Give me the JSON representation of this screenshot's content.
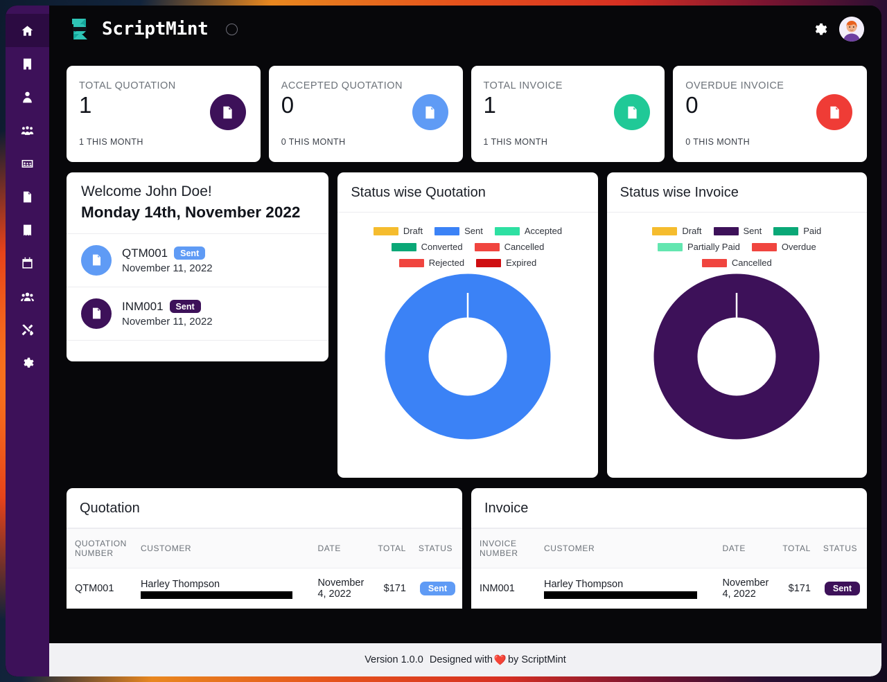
{
  "app": {
    "brand": "ScriptMint",
    "header_icons": {
      "gear": "gear-icon",
      "avatar": "user-avatar"
    }
  },
  "sidebar": {
    "items": [
      {
        "name": "home",
        "icon": "home-icon",
        "active": true
      },
      {
        "name": "company",
        "icon": "building-icon",
        "active": false
      },
      {
        "name": "client",
        "icon": "user-tie-icon",
        "active": false
      },
      {
        "name": "team",
        "icon": "users-cog-icon",
        "active": false
      },
      {
        "name": "meetings",
        "icon": "id-card-icon",
        "active": false
      },
      {
        "name": "quotation",
        "icon": "file-invoice-dollar-icon",
        "active": false
      },
      {
        "name": "invoice",
        "icon": "receipt-icon",
        "active": false
      },
      {
        "name": "calendar",
        "icon": "calendar-icon",
        "active": false
      },
      {
        "name": "users",
        "icon": "users-icon",
        "active": false
      },
      {
        "name": "tools",
        "icon": "tools-icon",
        "active": false
      },
      {
        "name": "settings",
        "icon": "gear-icon",
        "active": false
      }
    ]
  },
  "stats": [
    {
      "title": "TOTAL QUOTATION",
      "value": "1",
      "sub": "1 THIS MONTH",
      "color": "#3d1159",
      "icon": "file-invoice-dollar-icon"
    },
    {
      "title": "ACCEPTED QUOTATION",
      "value": "0",
      "sub": "0 THIS MONTH",
      "color": "#5f9bf5",
      "icon": "file-invoice-dollar-icon"
    },
    {
      "title": "TOTAL INVOICE",
      "value": "1",
      "sub": "1 THIS MONTH",
      "color": "#20c997",
      "icon": "file-invoice-icon"
    },
    {
      "title": "OVERDUE INVOICE",
      "value": "0",
      "sub": "0 THIS MONTH",
      "color": "#ef3c36",
      "icon": "file-invoice-icon"
    }
  ],
  "welcome": {
    "greeting": "Welcome John Doe!",
    "date": "Monday 14th, November 2022",
    "items": [
      {
        "number": "QTM001",
        "status": "Sent",
        "status_color": "#5f9bf5",
        "date": "November 11, 2022",
        "icon": "file-invoice-dollar-icon",
        "icon_bg": "#5f9bf5"
      },
      {
        "number": "INM001",
        "status": "Sent",
        "status_color": "#3d1159",
        "date": "November 11, 2022",
        "icon": "file-invoice-icon",
        "icon_bg": "#3d1159"
      }
    ]
  },
  "chart_data": [
    {
      "type": "pie",
      "title": "Status wise Quotation",
      "legend_position": "top",
      "categories": [
        "Draft",
        "Sent",
        "Accepted",
        "Converted",
        "Cancelled",
        "Rejected",
        "Expired"
      ],
      "values": [
        0,
        1,
        0,
        0,
        0,
        0,
        0
      ],
      "colors": [
        "#f5bc2e",
        "#3b82f6",
        "#2ee0a2",
        "#0aa877",
        "#f0453f",
        "#f0453f",
        "#cf0e12"
      ]
    },
    {
      "type": "pie",
      "title": "Status wise Invoice",
      "legend_position": "top",
      "categories": [
        "Draft",
        "Sent",
        "Paid",
        "Partially Paid",
        "Overdue",
        "Cancelled"
      ],
      "values": [
        0,
        1,
        0,
        0,
        0,
        0
      ],
      "colors": [
        "#f5bc2e",
        "#3d1159",
        "#0aa877",
        "#63e6b0",
        "#f0453f",
        "#f0453f"
      ]
    }
  ],
  "quotation_table": {
    "title": "Quotation",
    "columns": [
      "QUOTATION NUMBER",
      "CUSTOMER",
      "DATE",
      "TOTAL",
      "STATUS"
    ],
    "rows": [
      {
        "number": "QTM001",
        "customer": "Harley Thompson",
        "customer_redacted": true,
        "date": "November 4, 2022",
        "total": "$171",
        "status": "Sent",
        "status_color": "#5f9bf5"
      }
    ]
  },
  "invoice_table": {
    "title": "Invoice",
    "columns": [
      "INVOICE NUMBER",
      "CUSTOMER",
      "DATE",
      "TOTAL",
      "STATUS"
    ],
    "rows": [
      {
        "number": "INM001",
        "customer": "Harley Thompson",
        "customer_redacted": true,
        "date": "November 4, 2022",
        "total": "$171",
        "status": "Sent",
        "status_color": "#3d1159"
      }
    ]
  },
  "footer": {
    "version": "Version 1.0.0",
    "designed_prefix": "Designed with",
    "heart": "❤️",
    "designed_suffix": "by ScriptMint"
  }
}
